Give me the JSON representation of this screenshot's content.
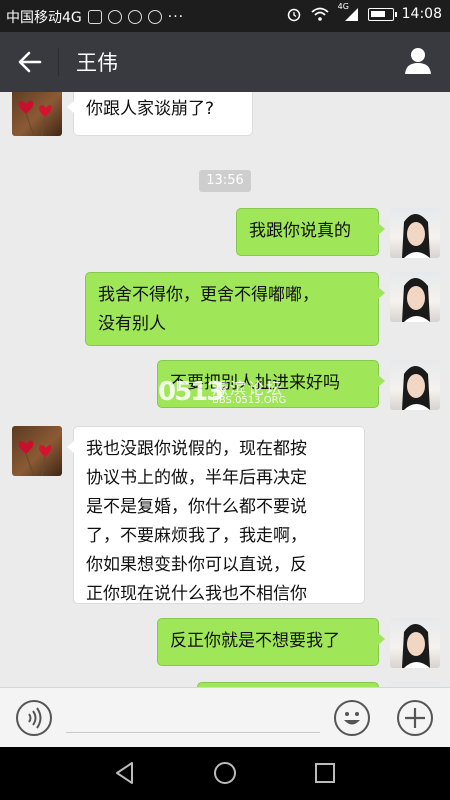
{
  "status_bar": {
    "carrier": "中国移动4G",
    "network": "4G",
    "time": "14:08"
  },
  "header": {
    "title": "王伟"
  },
  "chat": {
    "timestamp": "13:56",
    "messages": [
      {
        "from": "other",
        "lines": [
          "你跟人家谈崩了?"
        ]
      },
      {
        "from": "me",
        "lines": [
          "我跟你说真的"
        ]
      },
      {
        "from": "me",
        "lines": [
          "我舍不得你，更舍不得嘟嘟，",
          "没有别人"
        ]
      },
      {
        "from": "me",
        "lines": [
          "不要把别人扯进来好吗"
        ]
      },
      {
        "from": "other",
        "lines": [
          "我也没跟你说假的，现在都按",
          "协议书上的做，半年后再决定",
          "是不是复婚，你什么都不要说",
          "了，不要麻烦我了，我走啊，",
          "你如果想变卦你可以直说，反",
          "正你现在说什么我也不相信你"
        ]
      },
      {
        "from": "me",
        "lines": [
          "反正你就是不想要我了"
        ]
      }
    ]
  },
  "watermark": {
    "logo": "0513",
    "name": "濠滨论坛",
    "url": "BBS.0513.ORG"
  },
  "icons": {
    "back": "arrow-left-icon",
    "contact": "person-icon",
    "voice": "voice-icon",
    "emoji": "emoji-icon",
    "more": "plus-icon"
  },
  "colors": {
    "title_bar": "#393a3f",
    "my_bubble": "#9fe658",
    "their_bubble": "#ffffff",
    "chat_bg": "#ebebeb"
  }
}
